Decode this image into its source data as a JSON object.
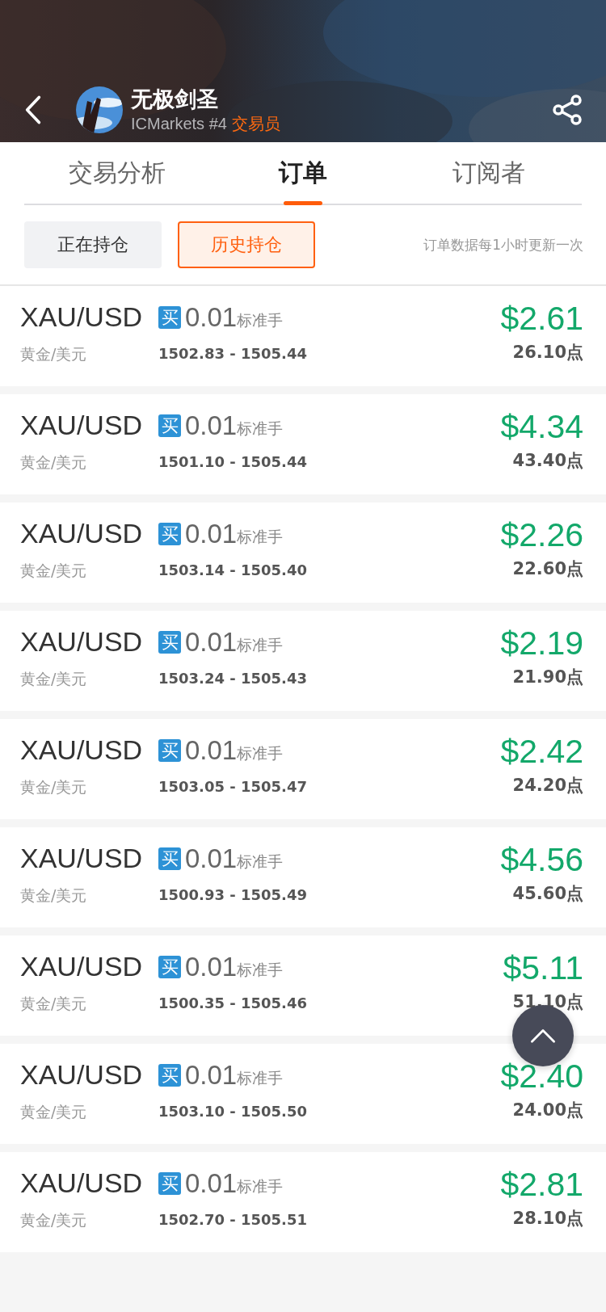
{
  "header": {
    "name": "无极剑圣",
    "broker": "ICMarkets #4",
    "role": "交易员"
  },
  "tabs": [
    {
      "label": "交易分析",
      "selected": false
    },
    {
      "label": "订单",
      "selected": true
    },
    {
      "label": "订阅者",
      "selected": false
    }
  ],
  "filters": [
    {
      "label": "正在持仓",
      "selected": false
    },
    {
      "label": "历史持仓",
      "selected": true
    }
  ],
  "update_note": "订单数据每1小时更新一次",
  "orders": [
    {
      "symbol": "XAU/USD",
      "name": "黄金/美元",
      "side": "买",
      "lots": "0.01",
      "unit": "标准手",
      "range": "1502.83 - 1505.44",
      "profit": "$2.61",
      "points": "26.10点"
    },
    {
      "symbol": "XAU/USD",
      "name": "黄金/美元",
      "side": "买",
      "lots": "0.01",
      "unit": "标准手",
      "range": "1501.10 - 1505.44",
      "profit": "$4.34",
      "points": "43.40点"
    },
    {
      "symbol": "XAU/USD",
      "name": "黄金/美元",
      "side": "买",
      "lots": "0.01",
      "unit": "标准手",
      "range": "1503.14 - 1505.40",
      "profit": "$2.26",
      "points": "22.60点"
    },
    {
      "symbol": "XAU/USD",
      "name": "黄金/美元",
      "side": "买",
      "lots": "0.01",
      "unit": "标准手",
      "range": "1503.24 - 1505.43",
      "profit": "$2.19",
      "points": "21.90点"
    },
    {
      "symbol": "XAU/USD",
      "name": "黄金/美元",
      "side": "买",
      "lots": "0.01",
      "unit": "标准手",
      "range": "1503.05 - 1505.47",
      "profit": "$2.42",
      "points": "24.20点"
    },
    {
      "symbol": "XAU/USD",
      "name": "黄金/美元",
      "side": "买",
      "lots": "0.01",
      "unit": "标准手",
      "range": "1500.93 - 1505.49",
      "profit": "$4.56",
      "points": "45.60点"
    },
    {
      "symbol": "XAU/USD",
      "name": "黄金/美元",
      "side": "买",
      "lots": "0.01",
      "unit": "标准手",
      "range": "1500.35 - 1505.46",
      "profit": "$5.11",
      "points": "51.10点"
    },
    {
      "symbol": "XAU/USD",
      "name": "黄金/美元",
      "side": "买",
      "lots": "0.01",
      "unit": "标准手",
      "range": "1503.10 - 1505.50",
      "profit": "$2.40",
      "points": "24.00点"
    },
    {
      "symbol": "XAU/USD",
      "name": "黄金/美元",
      "side": "买",
      "lots": "0.01",
      "unit": "标准手",
      "range": "1502.70 - 1505.51",
      "profit": "$2.81",
      "points": "28.10点"
    }
  ]
}
